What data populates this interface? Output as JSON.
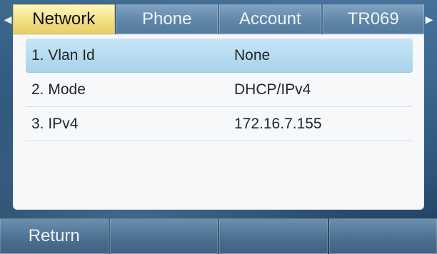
{
  "navigation": {
    "left_arrow": "◀",
    "right_arrow": "▶"
  },
  "tabs": [
    {
      "label": "Network"
    },
    {
      "label": "Phone"
    },
    {
      "label": "Account"
    },
    {
      "label": "TR069"
    }
  ],
  "active_tab": "Network",
  "settings": [
    {
      "label": "1. Vlan Id",
      "value": "None"
    },
    {
      "label": "2. Mode",
      "value": "DHCP/IPv4"
    },
    {
      "label": "3. IPv4",
      "value": "172.16.7.155"
    }
  ],
  "selected_row": "1. Vlan Id",
  "softkeys": [
    {
      "label": "Return"
    },
    {
      "label": ""
    },
    {
      "label": ""
    },
    {
      "label": ""
    }
  ]
}
